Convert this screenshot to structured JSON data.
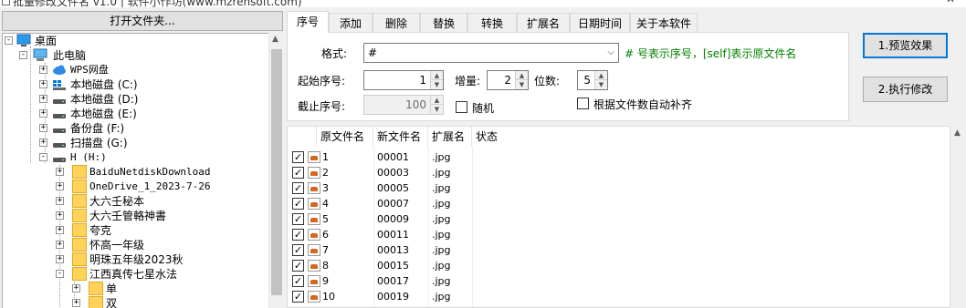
{
  "title_bar": {
    "text": "批量修改文件名 v1.0 | 软件小作坊(www.mzrensoft.com)",
    "minimize": "—",
    "close": "✕"
  },
  "left_panel": {
    "open_folder_label": "打开文件夹...",
    "tree": [
      {
        "label": "桌面",
        "icon": "desktop-icon",
        "expander": "-"
      },
      {
        "label": "此电脑",
        "icon": "computer-icon",
        "expander": "-"
      },
      {
        "label": "WPS网盘",
        "icon": "cloud-drive-icon",
        "expander": "+"
      },
      {
        "label": "本地磁盘 (C:)",
        "icon": "windows-drive-icon",
        "expander": "+"
      },
      {
        "label": "本地磁盘 (D:)",
        "icon": "hard-drive-icon",
        "expander": "+"
      },
      {
        "label": "本地磁盘 (E:)",
        "icon": "hard-drive-icon",
        "expander": "+"
      },
      {
        "label": "备份盘 (F:)",
        "icon": "hard-drive-icon",
        "expander": "+"
      },
      {
        "label": "扫描盘 (G:)",
        "icon": "hard-drive-icon",
        "expander": "+"
      },
      {
        "label": "H (H:)",
        "icon": "hard-drive-icon",
        "expander": "-"
      },
      {
        "label": "BaiduNetdiskDownload",
        "icon": "folder-icon",
        "expander": "+"
      },
      {
        "label": "OneDrive_1_2023-7-26",
        "icon": "folder-icon",
        "expander": "+"
      },
      {
        "label": "大六壬秘本",
        "icon": "folder-icon",
        "expander": "+"
      },
      {
        "label": "大六壬管輅神書",
        "icon": "folder-icon",
        "expander": "+"
      },
      {
        "label": "夸克",
        "icon": "folder-icon",
        "expander": "+"
      },
      {
        "label": "怀高一年级",
        "icon": "folder-icon",
        "expander": "+"
      },
      {
        "label": "明珠五年级2023秋",
        "icon": "folder-icon",
        "expander": "+"
      },
      {
        "label": "江西真传七星水法",
        "icon": "folder-icon",
        "expander": "-"
      },
      {
        "label": "单",
        "icon": "folder-icon",
        "expander": "+"
      },
      {
        "label": "双",
        "icon": "folder-icon",
        "expander": "+"
      }
    ]
  },
  "tabs": [
    "序号",
    "添加",
    "删除",
    "替换",
    "转换",
    "扩展名",
    "日期时间",
    "关于本软件"
  ],
  "active_tab": "序号",
  "format": {
    "label": "格式:",
    "value": "#",
    "hint": "# 号表示序号，[self]表示原文件名"
  },
  "start_index": {
    "label": "起始序号:",
    "value": "1"
  },
  "increment": {
    "label": "增量:",
    "value": "2"
  },
  "digits": {
    "label": "位数:",
    "value": "5"
  },
  "end_index": {
    "label": "截止序号:",
    "value": "100"
  },
  "random_label": "随机",
  "autopad_label": "根据文件数自动补齐",
  "buttons": {
    "preview": "1.预览效果",
    "execute": "2.执行修改"
  },
  "list": {
    "columns": [
      "原文件名",
      "新文件名",
      "扩展名",
      "状态"
    ],
    "rows": [
      {
        "original": "1",
        "new": "00001",
        "ext": ".jpg",
        "status": ""
      },
      {
        "original": "2",
        "new": "00003",
        "ext": ".jpg",
        "status": ""
      },
      {
        "original": "3",
        "new": "00005",
        "ext": ".jpg",
        "status": ""
      },
      {
        "original": "4",
        "new": "00007",
        "ext": ".jpg",
        "status": ""
      },
      {
        "original": "5",
        "new": "00009",
        "ext": ".jpg",
        "status": ""
      },
      {
        "original": "6",
        "new": "00011",
        "ext": ".jpg",
        "status": ""
      },
      {
        "original": "7",
        "new": "00013",
        "ext": ".jpg",
        "status": ""
      },
      {
        "original": "8",
        "new": "00015",
        "ext": ".jpg",
        "status": ""
      },
      {
        "original": "9",
        "new": "00017",
        "ext": ".jpg",
        "status": ""
      },
      {
        "original": "10",
        "new": "00019",
        "ext": ".jpg",
        "status": ""
      }
    ]
  },
  "colors": {
    "hint_green": "#008000",
    "default_button_border": "#0078d7",
    "folder_yellow": "#ffd35a"
  }
}
